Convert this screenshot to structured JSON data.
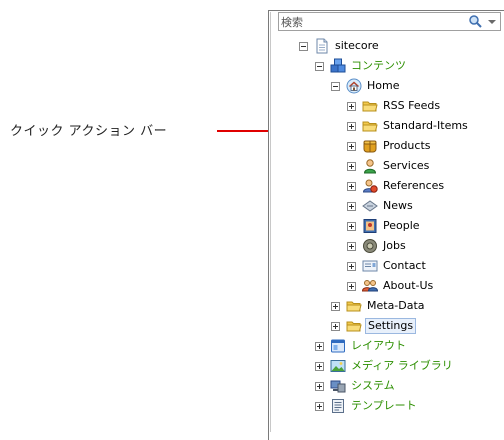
{
  "callout": {
    "label": "クイック アクション バー",
    "line_color": "#e00000"
  },
  "search": {
    "value": "検索",
    "icon": "search-icon"
  },
  "tree": {
    "root": {
      "label": "sitecore",
      "icon": "document-icon"
    },
    "content": {
      "label": "コンテンツ",
      "icon": "content-cubes-icon"
    },
    "home": {
      "label": "Home",
      "icon": "home-icon"
    },
    "home_children": [
      {
        "label": "RSS Feeds",
        "icon": "folder-icon"
      },
      {
        "label": "Standard-Items",
        "icon": "folder-icon"
      },
      {
        "label": "Products",
        "icon": "products-icon"
      },
      {
        "label": "Services",
        "icon": "services-icon"
      },
      {
        "label": "References",
        "icon": "references-icon"
      },
      {
        "label": "News",
        "icon": "news-icon"
      },
      {
        "label": "People",
        "icon": "people-icon"
      },
      {
        "label": "Jobs",
        "icon": "jobs-icon"
      },
      {
        "label": "Contact",
        "icon": "contact-icon"
      },
      {
        "label": "About-Us",
        "icon": "about-us-icon"
      }
    ],
    "meta_data": {
      "label": "Meta-Data",
      "icon": "folder-icon"
    },
    "settings": {
      "label": "Settings",
      "icon": "folder-icon",
      "selected": true
    },
    "layout": {
      "label": "レイアウト",
      "icon": "layout-icon"
    },
    "media_library": {
      "label": "メディア ライブラリ",
      "icon": "media-library-icon"
    },
    "system": {
      "label": "システム",
      "icon": "system-icon"
    },
    "templates": {
      "label": "テンプレート",
      "icon": "template-icon"
    }
  },
  "colors": {
    "green_label": "#2c8f00",
    "selection": "#e8f0fb"
  }
}
